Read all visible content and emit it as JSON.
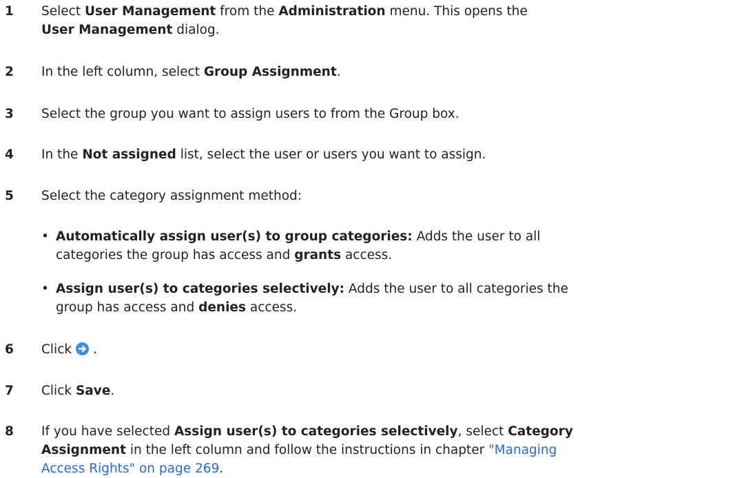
{
  "steps": [
    {
      "num": "1",
      "parts": [
        "Select ",
        "User Management",
        " from the ",
        "Administration",
        " menu. This opens the",
        "User Management",
        " dialog."
      ]
    },
    {
      "num": "2",
      "parts": [
        "In the left column, select ",
        "Group Assignment",
        "."
      ]
    },
    {
      "num": "3",
      "text": "Select the group you want to assign users to from the Group box."
    },
    {
      "num": "4",
      "parts": [
        "In the ",
        "Not assigned",
        " list, select the user or users you want to assign."
      ]
    },
    {
      "num": "5",
      "text": "Select the category assignment method:"
    },
    {
      "num": "6",
      "parts": [
        "Click",
        "."
      ]
    },
    {
      "num": "7",
      "parts": [
        "Click ",
        "Save",
        "."
      ]
    },
    {
      "num": "8",
      "parts": [
        "If you have selected ",
        "Assign user(s) to categories selectively",
        ", select ",
        "Category",
        "Assignment",
        " in the left column and follow the instructions in chapter ",
        "\"Managing",
        "Access Rights\" on page 269",
        "."
      ]
    }
  ],
  "bullets": [
    {
      "symbol": "•",
      "parts": [
        "Automatically assign user(s) to group categories:",
        " Adds the user to all",
        "categories the group has access and ",
        "grants",
        " access."
      ]
    },
    {
      "symbol": "•",
      "parts": [
        "Assign user(s) to categories selectively:",
        " Adds the user to all categories the",
        "group has access and ",
        "denies",
        " access."
      ]
    }
  ],
  "icons": {
    "next_button": "arrow-right-circle-icon"
  },
  "colors": {
    "link": "#2a6ad1",
    "icon": "#3f8fe0",
    "text": "#222222"
  }
}
